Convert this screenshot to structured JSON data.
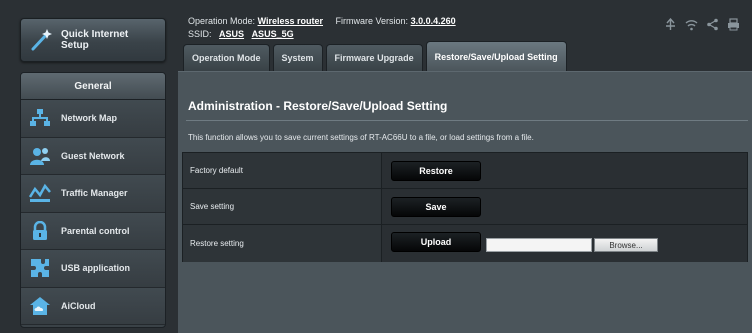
{
  "sidebar": {
    "quick_setup_label": "Quick Internet Setup",
    "quick_setup_icon": "wand-icon",
    "general_title": "General",
    "items": [
      {
        "label": "Network Map",
        "icon": "network-map-icon"
      },
      {
        "label": "Guest Network",
        "icon": "guest-network-icon"
      },
      {
        "label": "Traffic Manager",
        "icon": "traffic-manager-icon"
      },
      {
        "label": "Parental control",
        "icon": "parental-control-icon"
      },
      {
        "label": "USB application",
        "icon": "usb-application-icon"
      },
      {
        "label": "AiCloud",
        "icon": "aicloud-icon"
      }
    ]
  },
  "header": {
    "operation_mode_label": "Operation Mode:",
    "operation_mode_value": "Wireless router",
    "firmware_label": "Firmware Version:",
    "firmware_value": "3.0.0.4.260",
    "ssid_label": "SSID:",
    "ssid_values": [
      "ASUS",
      "ASUS_5G"
    ]
  },
  "tabs": [
    {
      "label": "Operation Mode",
      "active": false
    },
    {
      "label": "System",
      "active": false
    },
    {
      "label": "Firmware Upgrade",
      "active": false
    },
    {
      "label": "Restore/Save/Upload Setting",
      "active": true
    }
  ],
  "main": {
    "title": "Administration - Restore/Save/Upload Setting",
    "description": "This function allows you to save current settings of RT-AC66U to a file, or load settings from a file.",
    "rows": [
      {
        "label": "Factory default",
        "button": "Restore"
      },
      {
        "label": "Save setting",
        "button": "Save"
      },
      {
        "label": "Restore setting",
        "button": "Upload",
        "file_value": "",
        "browse_label": "Browse..."
      }
    ]
  },
  "colors": {
    "background": "#2b3034",
    "panel": "#4b555b",
    "table": "#2a3034",
    "button": "#0e1113",
    "accent_icon": "#5ab4e6"
  }
}
